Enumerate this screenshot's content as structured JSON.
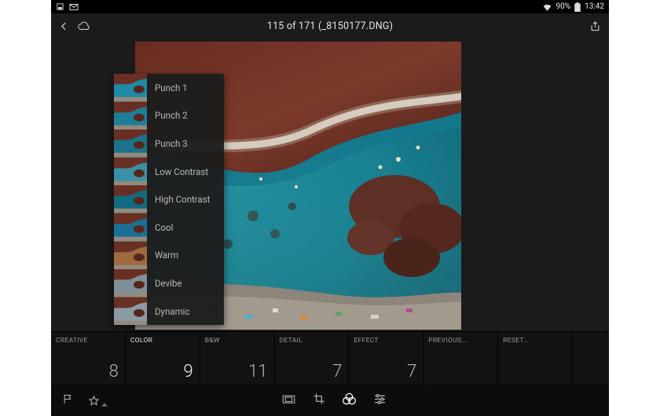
{
  "status_bar": {
    "battery_pct": "90%",
    "clock": "13:42"
  },
  "header": {
    "title": "115 of 171 (_8150177.DNG)"
  },
  "presets": {
    "items": [
      "Punch 1",
      "Punch 2",
      "Punch 3",
      "Low Contrast",
      "High Contrast",
      "Cool",
      "Warm",
      "Devibe",
      "Dynamic"
    ],
    "thumb_accents": [
      "#1f8aa5",
      "#1d7e98",
      "#1b728b",
      "#3a91a7",
      "#126b83",
      "#1b6f97",
      "#a06a3e",
      "#7d8f98",
      "#8c9aa3"
    ]
  },
  "strip": {
    "cells": [
      {
        "label": "CREATIVE",
        "value": "8",
        "active": false,
        "has_value": true
      },
      {
        "label": "COLOR",
        "value": "9",
        "active": true,
        "has_value": true
      },
      {
        "label": "B&W",
        "value": "11",
        "active": false,
        "has_value": true
      },
      {
        "label": "DETAIL",
        "value": "7",
        "active": false,
        "has_value": true
      },
      {
        "label": "EFFECT",
        "value": "7",
        "active": false,
        "has_value": true
      },
      {
        "label": "PREVIOUS...",
        "value": "",
        "active": false,
        "has_value": false
      },
      {
        "label": "RESET...",
        "value": "",
        "active": false,
        "has_value": false
      }
    ]
  }
}
